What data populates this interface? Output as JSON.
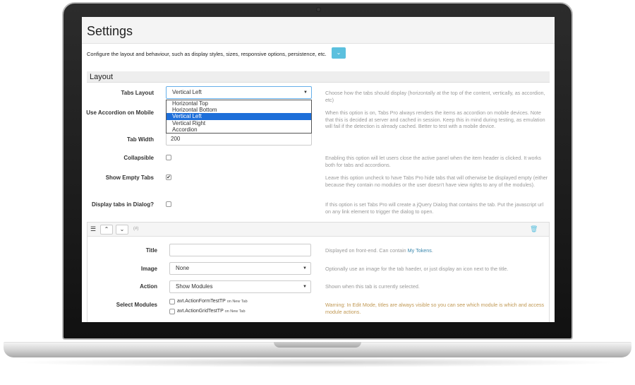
{
  "page": {
    "title": "Settings",
    "description": "Configure the layout and behaviour, such as display styles, sizes, responsive options, persistence, etc.",
    "info_button_icon": "chevron-down-icon"
  },
  "layout_section": {
    "title": "Layout",
    "tabs_layout": {
      "label": "Tabs Layout",
      "value": "Vertical Left",
      "help": "Choose how the tabs should display (horizontally at the top of the content, vertically, as accordion, etc)",
      "options": [
        "Horizontal Top",
        "Horizontal Bottom",
        "Vertical Left",
        "Vertical Right",
        "Accordion"
      ],
      "selected_index": 2
    },
    "use_accordion_mobile": {
      "label": "Use Accordion on Mobile",
      "help": "When this option is on, Tabs Pro always renders the items as accordion on mobile devices. Note that this is decided at server and cached in session. Keep this in mind during testing, as emulation will fail if the detection is already cached. Better to test with a mobile device."
    },
    "tab_width": {
      "label": "Tab Width",
      "value": "200"
    },
    "collapsible": {
      "label": "Collapsible",
      "checked": false,
      "help": "Enabling this option will let users close the active panel when the item header is clicked. It works both for tabs and accordions."
    },
    "show_empty_tabs": {
      "label": "Show Empty Tabs",
      "checked": true,
      "help": "Leave this option uncheck to have Tabs Pro hide tabs that will otherwise be displayed empty (either because they contain no modules or the user doesn't have view rights to any of the modules)."
    },
    "display_in_dialog": {
      "label": "Display tabs in Dialog?",
      "checked": false,
      "help": "If this option is set Tabs Pro will create a jQuery Dialog that contains the tab. Put the javascript url on any link element to trigger the dialog to open."
    }
  },
  "tab_editor": {
    "hash_label": "(#)",
    "title": {
      "label": "Title",
      "value": "",
      "help_prefix": "Displayed on front-end. Can contain ",
      "help_link": "My Tokens",
      "help_suffix": "."
    },
    "image": {
      "label": "Image",
      "value": "None",
      "help": "Optionally use an image for the tab haeder, or just display an icon next to the title."
    },
    "action": {
      "label": "Action",
      "value": "Show Modules",
      "help": "Shown when this tab is currently selected."
    },
    "select_modules": {
      "label": "Select Modules",
      "items": [
        {
          "name": "avt.ActionFormTestTP",
          "suffix": "on New Tab"
        },
        {
          "name": "avt.ActionGridTestTP",
          "suffix": "on New Tab"
        }
      ],
      "warning": "Warning: In Edit Mode, titles are always visible so you can see which module is which and access module actions."
    }
  }
}
